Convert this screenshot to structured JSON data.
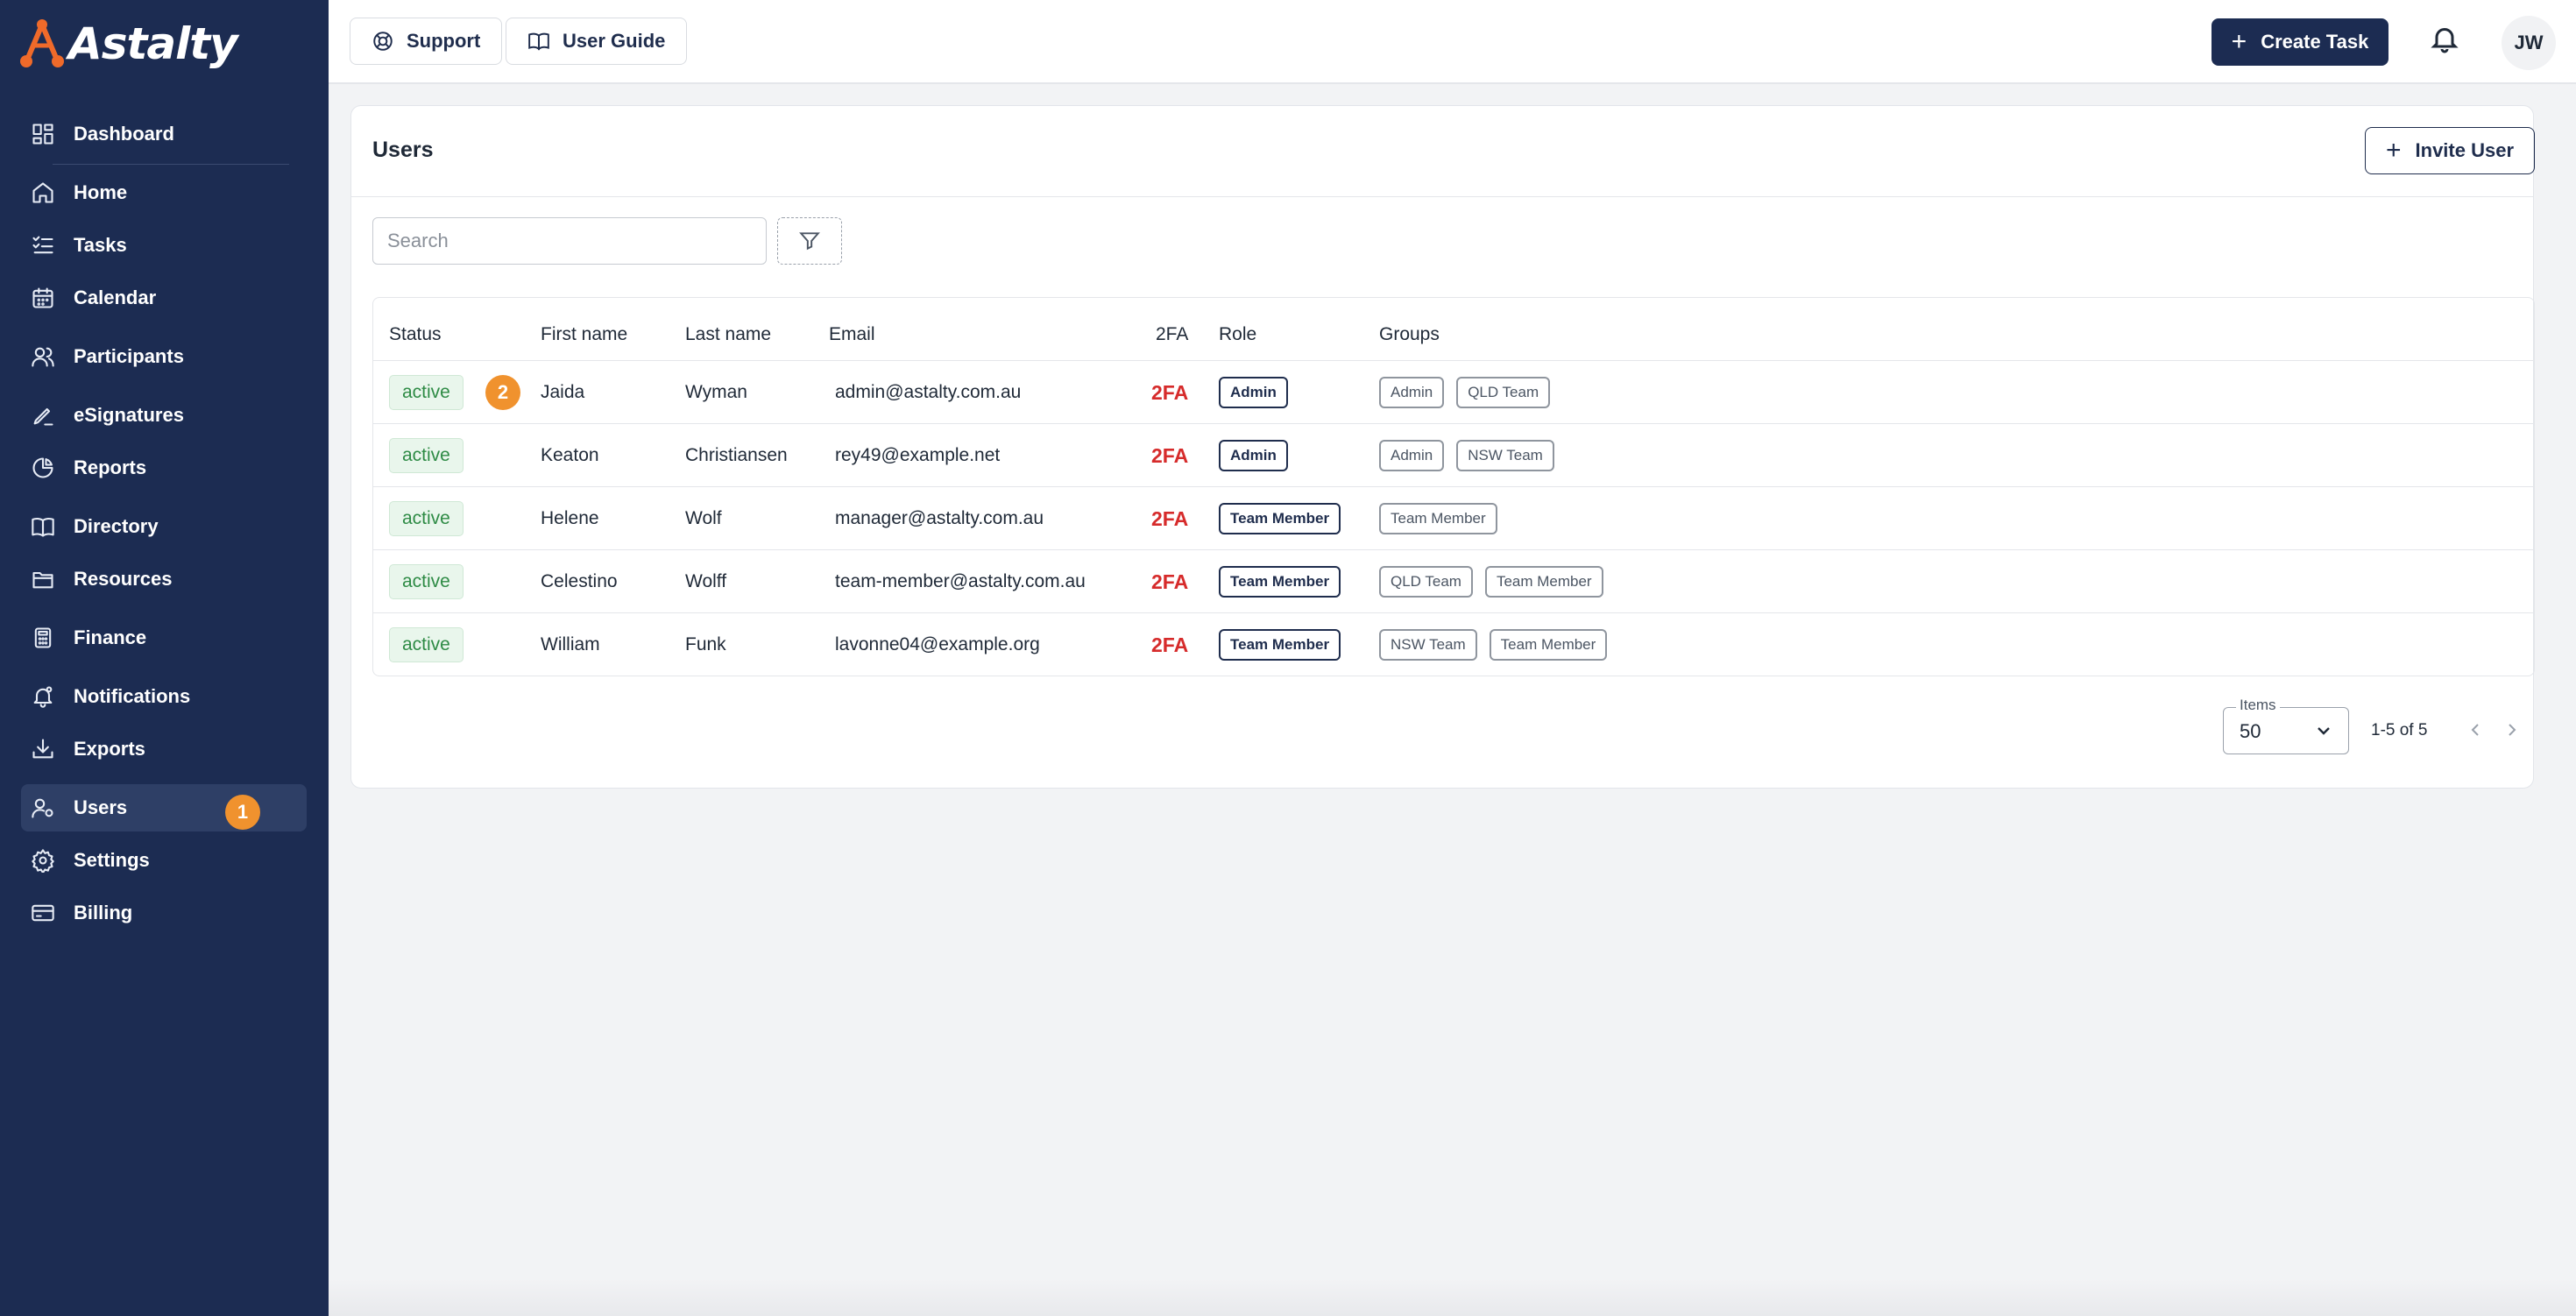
{
  "app": {
    "logo_text": "Astalty"
  },
  "sidebar": {
    "items": [
      {
        "label": "Dashboard",
        "icon": "dashboard-icon"
      },
      {
        "label": "Home",
        "icon": "home-icon"
      },
      {
        "label": "Tasks",
        "icon": "tasks-icon"
      },
      {
        "label": "Calendar",
        "icon": "calendar-icon"
      },
      {
        "label": "Participants",
        "icon": "participants-icon"
      },
      {
        "label": "eSignatures",
        "icon": "esignatures-icon"
      },
      {
        "label": "Reports",
        "icon": "reports-icon"
      },
      {
        "label": "Directory",
        "icon": "directory-icon"
      },
      {
        "label": "Resources",
        "icon": "folder-icon"
      },
      {
        "label": "Finance",
        "icon": "calculator-icon"
      },
      {
        "label": "Notifications",
        "icon": "notifications-icon"
      },
      {
        "label": "Exports",
        "icon": "download-icon"
      },
      {
        "label": "Users",
        "icon": "user-settings-icon",
        "active": true
      },
      {
        "label": "Settings",
        "icon": "gear-icon"
      },
      {
        "label": "Billing",
        "icon": "credit-card-icon"
      }
    ],
    "step_badge": "1"
  },
  "topbar": {
    "support_label": "Support",
    "guide_label": "User Guide",
    "create_label": "Create Task",
    "avatar_initials": "JW"
  },
  "users_card": {
    "title": "Users",
    "invite_label": "Invite User",
    "search_placeholder": "Search",
    "step_badge": "2",
    "columns": [
      "Status",
      "First name",
      "Last name",
      "Email",
      "2FA",
      "Role",
      "Groups"
    ],
    "rows": [
      {
        "status": "active",
        "first": "Jaida",
        "last": "Wyman",
        "email": "admin@astalty.com.au",
        "tfa": "2FA",
        "role": "Admin",
        "groups": [
          "Admin",
          "QLD Team"
        ]
      },
      {
        "status": "active",
        "first": "Keaton",
        "last": "Christiansen",
        "email": "rey49@example.net",
        "tfa": "2FA",
        "role": "Admin",
        "groups": [
          "Admin",
          "NSW Team"
        ]
      },
      {
        "status": "active",
        "first": "Helene",
        "last": "Wolf",
        "email": "manager@astalty.com.au",
        "tfa": "2FA",
        "role": "Team Member",
        "groups": [
          "Team Member"
        ]
      },
      {
        "status": "active",
        "first": "Celestino",
        "last": "Wolff",
        "email": "team-member@astalty.com.au",
        "tfa": "2FA",
        "role": "Team Member",
        "groups": [
          "QLD Team",
          "Team Member"
        ]
      },
      {
        "status": "active",
        "first": "William",
        "last": "Funk",
        "email": "lavonne04@example.org",
        "tfa": "2FA",
        "role": "Team Member",
        "groups": [
          "NSW Team",
          "Team Member"
        ]
      }
    ],
    "pagination": {
      "items_label": "Items",
      "items_value": "50",
      "range": "1-5 of 5"
    }
  },
  "colors": {
    "sidebar_bg": "#1c2c52",
    "accent_orange": "#f0922e",
    "tfa_red": "#d62b2b",
    "status_green": "#2e8b45"
  }
}
